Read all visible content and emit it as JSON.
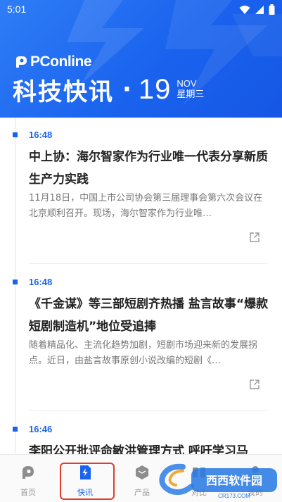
{
  "status_bar": {
    "time": "5:01"
  },
  "header": {
    "brand": "PConline",
    "title": "科技快讯",
    "separator": "·",
    "day": "19",
    "month": "NOV",
    "weekday": "星期三"
  },
  "feed": {
    "items": [
      {
        "time": "16:48",
        "headline": "中上协：海尔智家作为行业唯一代表分享新质生产力实践",
        "summary": "11月18日，中国上市公司协会第三届理事会第六次会议在北京顺利召开。现场，海尔智家作为行业唯…"
      },
      {
        "time": "16:48",
        "headline": "《千金谋》等三部短剧齐热播 盐言故事“爆款短剧制造机”地位受追捧",
        "summary": "随着精品化、主流化趋势加剧，短剧市场迎来新的发展拐点。近日，由盐言故事原创小说改编的短剧《…"
      },
      {
        "time": "16:46",
        "headline": "李阳公开批评命敏洪管理方式 呼吁学习马",
        "summary": ""
      }
    ]
  },
  "tabbar": {
    "tabs": [
      {
        "label": "首页",
        "icon": "home-icon"
      },
      {
        "label": "快讯",
        "icon": "flash-news-icon"
      },
      {
        "label": "产品",
        "icon": "product-icon"
      },
      {
        "label": "对比",
        "icon": "compare-icon"
      },
      {
        "label": "我的",
        "icon": "profile-icon"
      }
    ],
    "active_index": 1
  },
  "watermark": {
    "text": "西西软件园",
    "url_text": "CR173.COM"
  },
  "colors": {
    "header_blue": "#1a63ee",
    "accent_blue": "#1a63ee",
    "highlight_red": "#e13b2c"
  }
}
